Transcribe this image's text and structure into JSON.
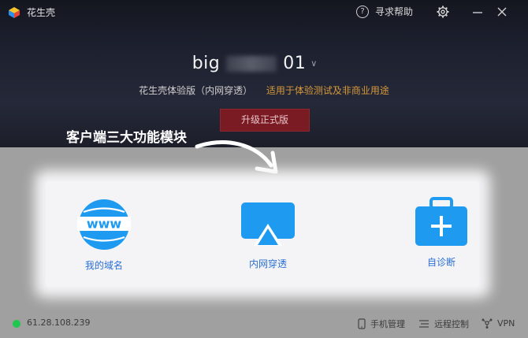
{
  "titlebar": {
    "app_name": "花生壳",
    "help_label": "寻求帮助",
    "settings_icon": "gear-icon",
    "minimize_icon": "minimize-icon",
    "close_icon": "close-icon"
  },
  "account": {
    "name_prefix": "big",
    "name_suffix": "01",
    "dropdown_icon": "chevron-down-icon"
  },
  "edition": {
    "text": "花生壳体验版（内网穿透）",
    "usage_note": "适用于体验测试及非商业用途"
  },
  "upgrade_button": "升级正式版",
  "annotation": "客户端三大功能模块",
  "features": [
    {
      "icon": "www-globe-icon",
      "label": "我的域名"
    },
    {
      "icon": "airplay-icon",
      "label": "内网穿透"
    },
    {
      "icon": "toolbox-plus-icon",
      "label": "自诊断"
    }
  ],
  "statusbar": {
    "ip": "61.28.108.239",
    "phone_manage": "手机管理",
    "remote_control": "远程控制",
    "vpn": "VPN"
  },
  "colors": {
    "header_bg": "#1e2130",
    "usage_note": "#d79a3a",
    "upgrade_bg": "#7a1b24",
    "feature_blue": "#1e9bf0",
    "status_online": "#1ec74d"
  }
}
